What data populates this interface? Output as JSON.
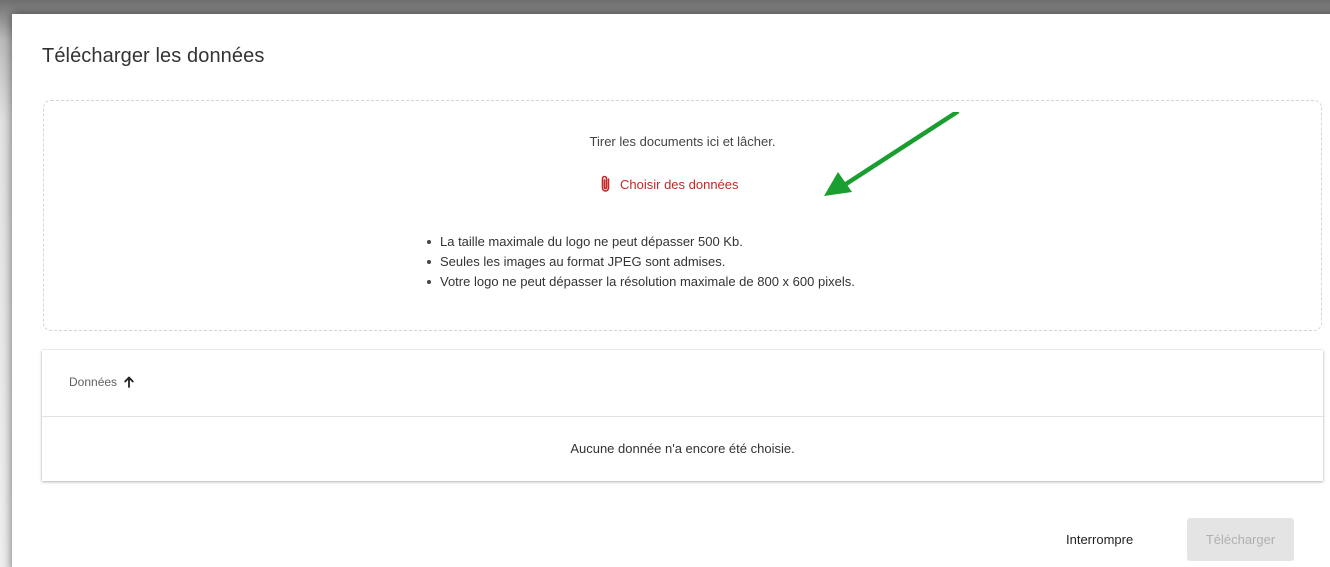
{
  "dialog": {
    "title": "Télécharger les données"
  },
  "dropzone": {
    "hint": "Tirer les documents ici et lâcher.",
    "choose_label": "Choisir des données",
    "choose_icon": "paperclip-icon",
    "accent_color": "#c62828",
    "rules": [
      "La taille maximale du logo ne peut dépasser 500 Kb.",
      "Seules les images au format JPEG sont admises.",
      "Votre logo ne peut dépasser la résolution maximale de 800 x 600 pixels."
    ]
  },
  "table": {
    "column_header": "Données",
    "sort_icon": "arrow-up-icon",
    "empty_message": "Aucune donnée n'a encore été choisie."
  },
  "actions": {
    "cancel_label": "Interrompre",
    "upload_label": "Télécharger",
    "upload_disabled": true
  },
  "annotation": {
    "arrow_color": "#1a9e2f"
  }
}
